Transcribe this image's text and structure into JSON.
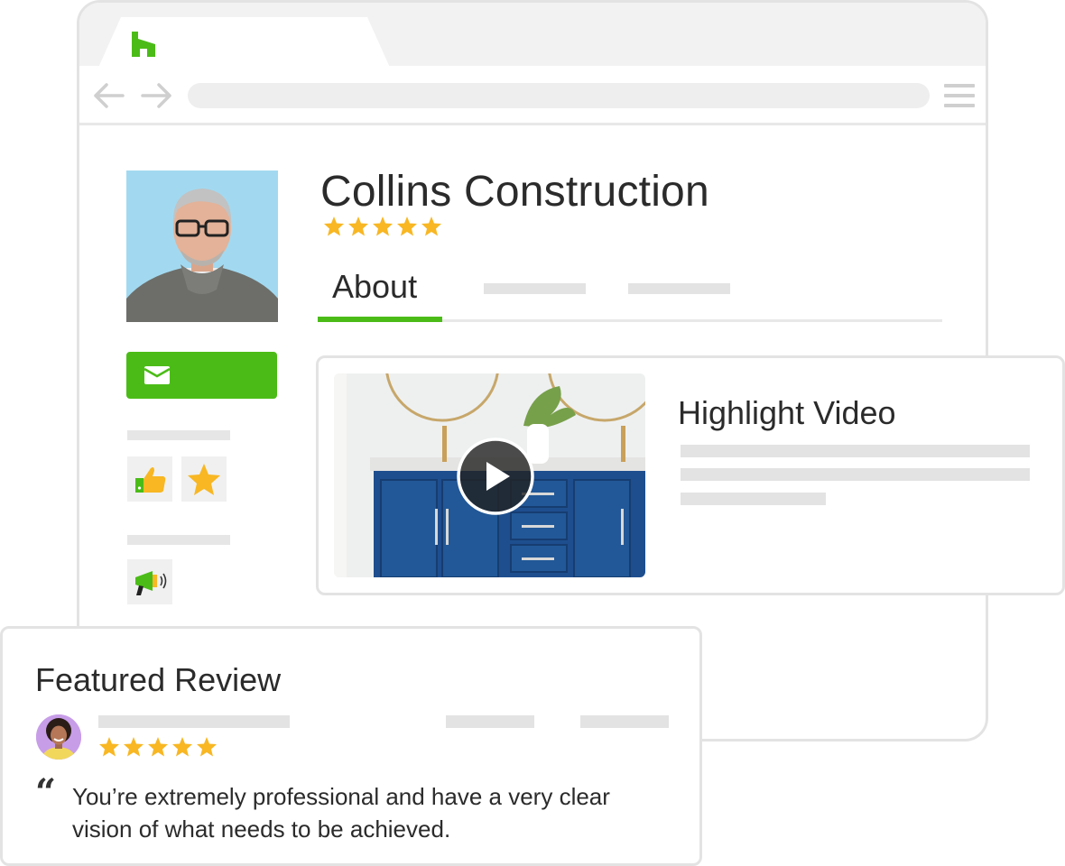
{
  "browser": {
    "logo_icon": "houzz-logo-icon",
    "back_icon": "arrow-left-icon",
    "forward_icon": "arrow-right-icon",
    "menu_icon": "hamburger-menu-icon"
  },
  "profile": {
    "business_name": "Collins Construction",
    "rating_stars": 5,
    "contact_button_icon": "mail-icon",
    "badges": [
      "thumbs-up-icon",
      "star-icon"
    ],
    "promo_icon": "megaphone-icon"
  },
  "tabs": {
    "active_label": "About"
  },
  "video": {
    "title": "Highlight Video",
    "play_icon": "play-icon"
  },
  "review": {
    "title": "Featured Review",
    "rating_stars": 5,
    "text": "You’re extremely professional and have a very clear vision of what needs to be achieved."
  },
  "colors": {
    "brand_green": "#4bbc17",
    "star_yellow": "#f8b723",
    "placeholder_gray": "#e6e6e6"
  }
}
